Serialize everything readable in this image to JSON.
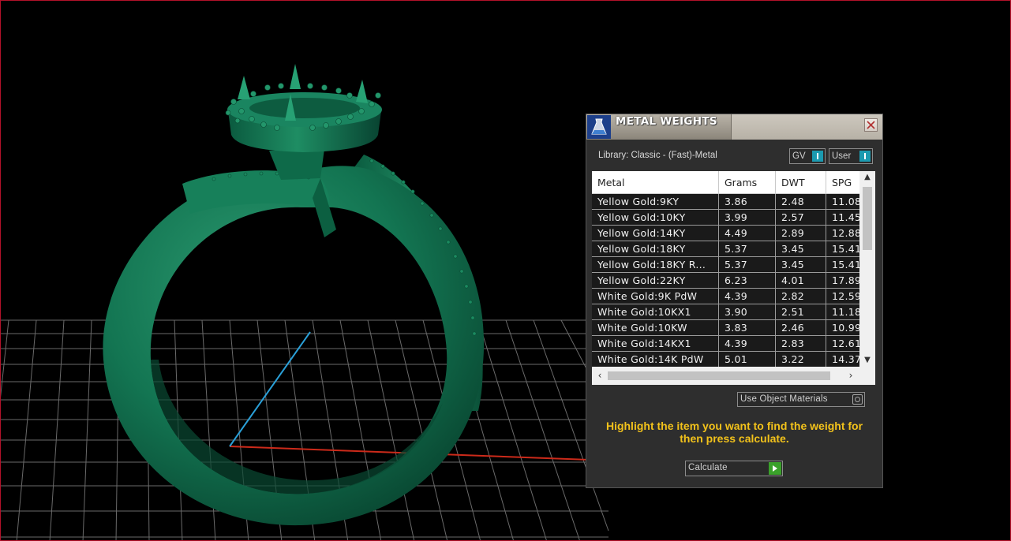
{
  "window": {
    "title": "METAL WEIGHTS",
    "close_icon": "close-icon",
    "app_icon": "flask-icon"
  },
  "library": {
    "label": "Library: Classic - (Fast)-Metal",
    "gv_label": "GV",
    "user_label": "User"
  },
  "table": {
    "columns": [
      "Metal",
      "Grams",
      "DWT",
      "SPG"
    ],
    "rows": [
      [
        "Yellow Gold:9KY",
        "3.86",
        "2.48",
        "11.08"
      ],
      [
        "Yellow Gold:10KY",
        "3.99",
        "2.57",
        "11.45"
      ],
      [
        "Yellow Gold:14KY",
        "4.49",
        "2.89",
        "12.88"
      ],
      [
        "Yellow Gold:18KY",
        "5.37",
        "3.45",
        "15.41"
      ],
      [
        "Yellow Gold:18KY R...",
        "5.37",
        "3.45",
        "15.41"
      ],
      [
        "Yellow Gold:22KY",
        "6.23",
        "4.01",
        "17.89"
      ],
      [
        "White Gold:9K PdW",
        "4.39",
        "2.82",
        "12.59"
      ],
      [
        "White Gold:10KX1",
        "3.90",
        "2.51",
        "11.18"
      ],
      [
        "White Gold:10KW",
        "3.83",
        "2.46",
        "10.99"
      ],
      [
        "White Gold:14KX1",
        "4.39",
        "2.83",
        "12.61"
      ],
      [
        "White Gold:14K PdW",
        "5.01",
        "3.22",
        "14.37"
      ]
    ]
  },
  "options": {
    "use_object_materials": "Use Object Materials"
  },
  "hint": "Highlight the item you want to find the weight for then press calculate.",
  "actions": {
    "calculate": "Calculate"
  },
  "colors": {
    "ring": "#0f6b4a",
    "accent_text": "#f2c21b",
    "toggle_knob": "#1b9ab0",
    "go_button": "#3aa12a",
    "axis_x": "#cc2a1a",
    "axis_y": "#2aa0d8",
    "frame_border": "#b3122a"
  }
}
